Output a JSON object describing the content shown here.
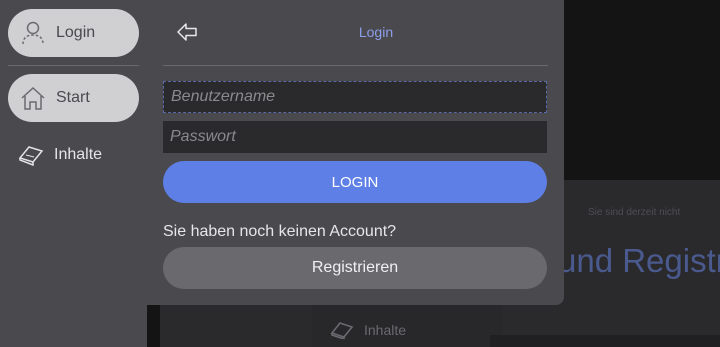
{
  "sidebar": {
    "items": [
      {
        "label": "Login",
        "icon": "user-icon"
      },
      {
        "label": "Start",
        "icon": "home-icon"
      },
      {
        "label": "Inhalte",
        "icon": "book-icon"
      }
    ]
  },
  "login": {
    "title": "Login",
    "username_placeholder": "Benutzername",
    "password_placeholder": "Passwort",
    "login_label": "LOGIN",
    "no_account_text": "Sie haben noch keinen Account?",
    "register_label": "Registrieren"
  },
  "background": {
    "small_text": "Sie sind derzeit nicht",
    "heading": "und Registr",
    "sidebar_item": "Inhalte"
  },
  "colors": {
    "accent": "#5e7fe6",
    "title_link": "#8b9ee8",
    "panel": "#4a494e"
  }
}
